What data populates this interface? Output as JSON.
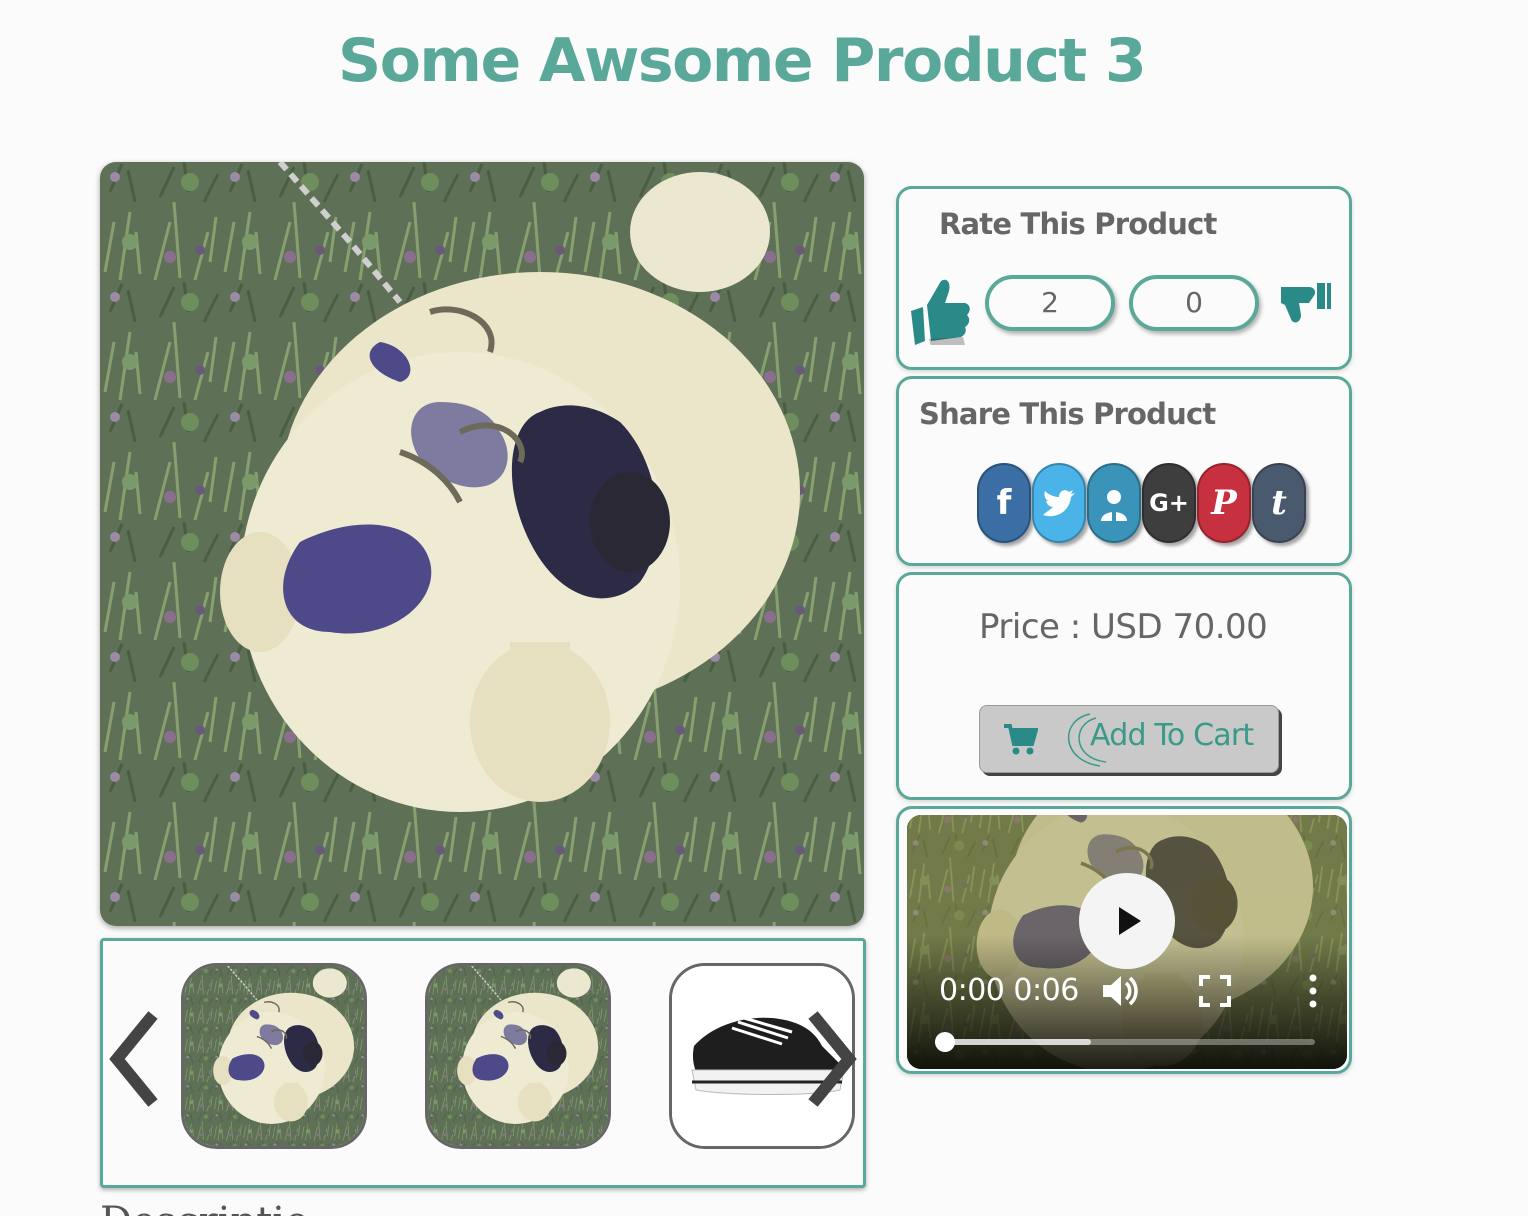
{
  "product": {
    "title": "Some Awsome Product 3"
  },
  "gallery": {
    "main_image": "pug-photo",
    "thumbnails": [
      {
        "image": "pug-photo"
      },
      {
        "image": "pug-photo"
      },
      {
        "image": "black-sneaker"
      }
    ],
    "prev_icon": "chevron-left-icon",
    "next_icon": "chevron-right-icon"
  },
  "description": {
    "heading": "Description"
  },
  "rating": {
    "title": "Rate This Product",
    "likes": "2",
    "dislikes": "0",
    "like_icon": "thumbs-up-icon",
    "dislike_icon": "thumbs-down-icon",
    "accent_color": "#2a8a88"
  },
  "share": {
    "title": "Share This Product",
    "networks": [
      {
        "name": "facebook",
        "glyph": "f",
        "color": "#3a6ea5"
      },
      {
        "name": "twitter",
        "glyph": "",
        "color": "#4ab3e8"
      },
      {
        "name": "linkedin",
        "glyph": "",
        "color": "#3a93b8"
      },
      {
        "name": "google-plus",
        "glyph": "G+",
        "color": "#3e3e3e"
      },
      {
        "name": "pinterest",
        "glyph": "P",
        "color": "#c7303f"
      },
      {
        "name": "tumblr",
        "glyph": "t",
        "color": "#4a5a6e"
      }
    ]
  },
  "purchase": {
    "price_text": "Price : USD 70.00",
    "add_to_cart": "Add To Cart",
    "cart_icon": "shopping-cart-icon"
  },
  "video": {
    "current_time": "0:00",
    "duration": "0:06",
    "progress": 0.0,
    "buffered": 0.4,
    "play_icon": "play-icon",
    "volume_icon": "volume-icon",
    "fullscreen_icon": "fullscreen-icon",
    "menu_icon": "more-vert-icon"
  },
  "theme": {
    "accent": "#5aa89a"
  }
}
